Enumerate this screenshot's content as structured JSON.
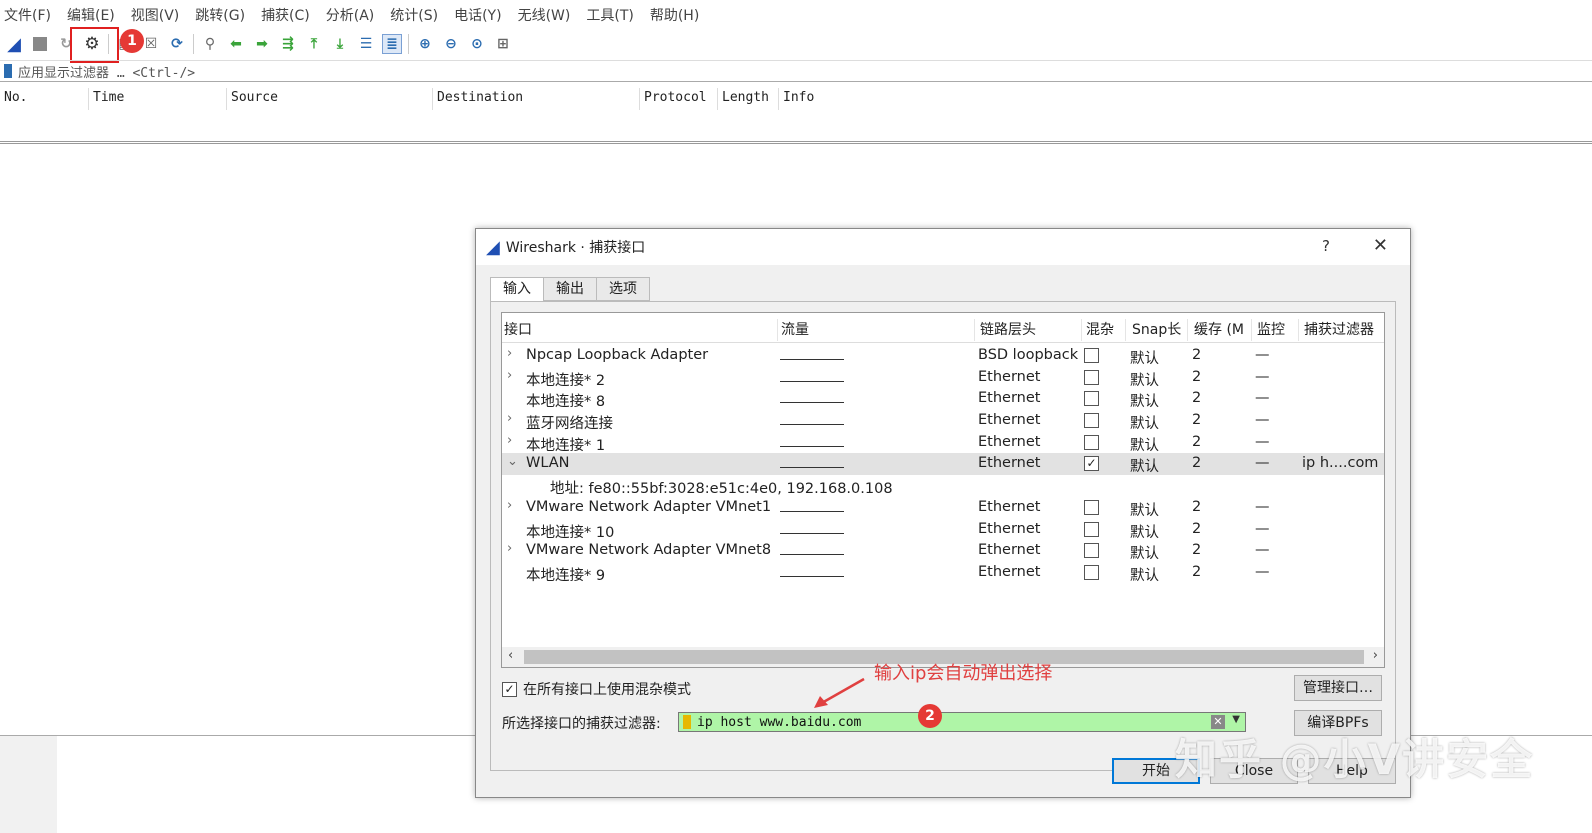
{
  "menu": [
    "文件(F)",
    "编辑(E)",
    "视图(V)",
    "跳转(G)",
    "捕获(C)",
    "分析(A)",
    "统计(S)",
    "电话(Y)",
    "无线(W)",
    "工具(T)",
    "帮助(H)"
  ],
  "toolbar": {
    "icons": [
      "shark-fin-start-icon",
      "stop-icon",
      "restart-icon",
      "capture-options-gear-icon",
      "open-file-icon",
      "close-file-icon",
      "reload-icon",
      "find-icon",
      "back-arrow-icon",
      "forward-arrow-icon",
      "goto-packet-icon",
      "first-packet-icon",
      "last-packet-icon",
      "autoscroll-icon",
      "colorize-icon",
      "zoom-in-icon",
      "zoom-out-icon",
      "zoom-normal-icon",
      "resize-columns-icon"
    ],
    "badge1": "1"
  },
  "filterbar": {
    "placeholder": "应用显示过滤器 … <Ctrl-/>"
  },
  "packet_columns": [
    "No.",
    "Time",
    "Source",
    "Destination",
    "Protocol",
    "Length",
    "Info"
  ],
  "dialog": {
    "title": "Wireshark · 捕获接口",
    "help": "?",
    "tabs": [
      "输入",
      "输出",
      "选项"
    ],
    "headers": [
      "接口",
      "流量",
      "链路层头",
      "混杂",
      "Snap长",
      "缓存 (M",
      "监控",
      "捕获过滤器"
    ],
    "rows": [
      {
        "chev": "›",
        "name": "Npcap Loopback Adapter",
        "link": "BSD loopback",
        "check": "",
        "snap": "默认",
        "buf": "2",
        "mon": "—",
        "filter": ""
      },
      {
        "chev": "›",
        "name": "本地连接* 2",
        "link": "Ethernet",
        "check": "",
        "snap": "默认",
        "buf": "2",
        "mon": "—",
        "filter": ""
      },
      {
        "chev": "",
        "name": "本地连接* 8",
        "link": "Ethernet",
        "check": "",
        "snap": "默认",
        "buf": "2",
        "mon": "—",
        "filter": ""
      },
      {
        "chev": "›",
        "name": "蓝牙网络连接",
        "link": "Ethernet",
        "check": "",
        "snap": "默认",
        "buf": "2",
        "mon": "—",
        "filter": ""
      },
      {
        "chev": "›",
        "name": "本地连接* 1",
        "link": "Ethernet",
        "check": "",
        "snap": "默认",
        "buf": "2",
        "mon": "—",
        "filter": ""
      },
      {
        "chev": "⌄",
        "name": "WLAN",
        "link": "Ethernet",
        "check": "✓",
        "snap": "默认",
        "buf": "2",
        "mon": "—",
        "filter": "ip h....com",
        "selected": true
      },
      {
        "chev": "",
        "name": "",
        "sub": "地址: fe80::55bf:3028:e51c:4e0, 192.168.0.108",
        "link": "",
        "nocb": true,
        "snap": "",
        "buf": "",
        "mon": "",
        "filter": ""
      },
      {
        "chev": "›",
        "name": "VMware Network Adapter VMnet1",
        "link": "Ethernet",
        "check": "",
        "snap": "默认",
        "buf": "2",
        "mon": "—",
        "filter": ""
      },
      {
        "chev": "",
        "name": "本地连接* 10",
        "link": "Ethernet",
        "check": "",
        "snap": "默认",
        "buf": "2",
        "mon": "—",
        "filter": ""
      },
      {
        "chev": "›",
        "name": "VMware Network Adapter VMnet8",
        "link": "Ethernet",
        "check": "",
        "snap": "默认",
        "buf": "2",
        "mon": "—",
        "filter": ""
      },
      {
        "chev": "",
        "name": "本地连接* 9",
        "link": "Ethernet",
        "check": "",
        "snap": "默认",
        "buf": "2",
        "mon": "—",
        "filter": ""
      }
    ],
    "promisc_label": "在所有接口上使用混杂模式",
    "filter_label": "所选择接口的捕获过滤器:",
    "filter_value": "ip host www.baidu.com",
    "manage_button": "管理接口…",
    "bpf_button": "编译BPFs",
    "start_button": "开始",
    "close_button": "Close",
    "help_button": "Help",
    "badge2": "2"
  },
  "annotation": "输入ip会自动弹出选择",
  "watermark": "知乎 @小V讲安全",
  "colors": {
    "accent": "#0078d7",
    "annotation": "#e04040",
    "filter_ok": "#aff5a7"
  }
}
